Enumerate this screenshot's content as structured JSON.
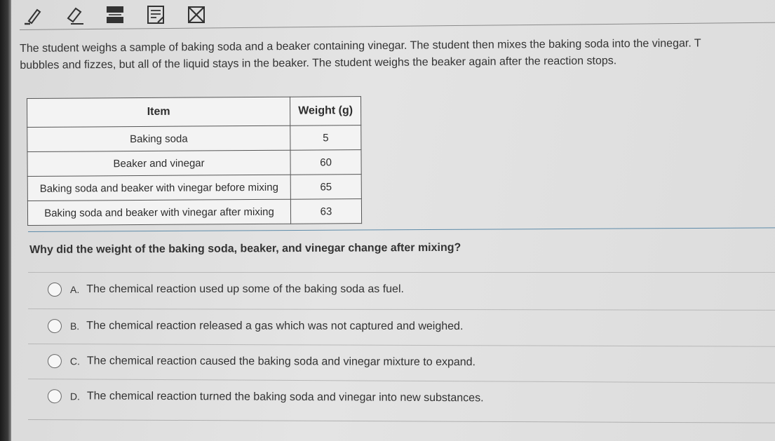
{
  "toolbar": {
    "tools": [
      {
        "icon": "pencil-icon"
      },
      {
        "icon": "eraser-icon"
      },
      {
        "icon": "line-reader-icon"
      },
      {
        "icon": "notepad-icon"
      },
      {
        "icon": "answer-eliminator-icon"
      }
    ]
  },
  "passage": {
    "line1": "The student weighs a sample of baking soda and a beaker containing vinegar. The student then mixes the baking soda into the vinegar. T",
    "line2": "bubbles and fizzes, but all of the liquid stays in the beaker. The student weighs the beaker again after the reaction stops."
  },
  "table": {
    "headers": [
      "Item",
      "Weight (g)"
    ],
    "rows": [
      {
        "item": "Baking soda",
        "weight": "5"
      },
      {
        "item": "Beaker and vinegar",
        "weight": "60"
      },
      {
        "item": "Baking soda and beaker with vinegar before mixing",
        "weight": "65"
      },
      {
        "item": "Baking soda and beaker with vinegar after mixing",
        "weight": "63"
      }
    ]
  },
  "question": "Why did the weight of the baking soda, beaker, and vinegar change after mixing?",
  "choices": [
    {
      "letter": "A.",
      "text": "The chemical reaction used up some of the baking soda as fuel."
    },
    {
      "letter": "B.",
      "text": "The chemical reaction released a gas which was not captured and weighed."
    },
    {
      "letter": "C.",
      "text": "The chemical reaction caused the baking soda and vinegar mixture to expand."
    },
    {
      "letter": "D.",
      "text": "The chemical reaction turned the baking soda and vinegar into new substances."
    }
  ]
}
